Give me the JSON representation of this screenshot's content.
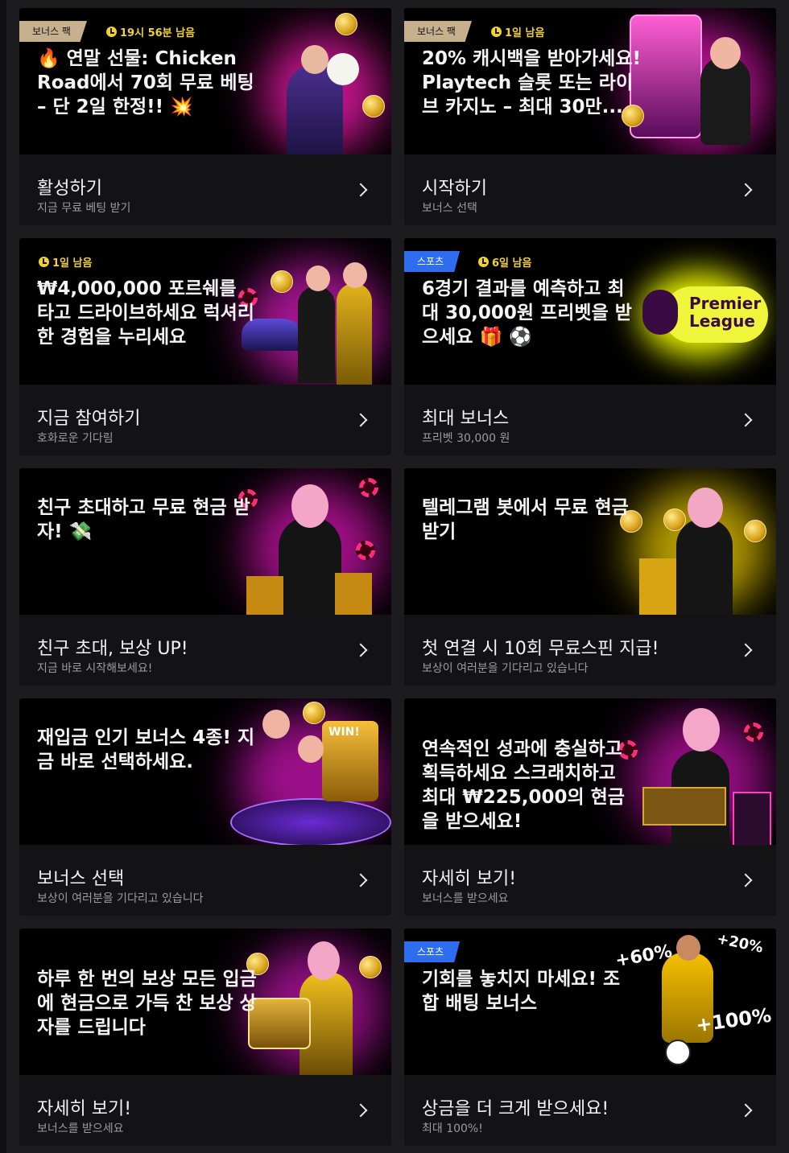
{
  "cards": [
    {
      "tag": "보너스 팩",
      "timer": "19시 56분 남음",
      "headline": "🔥 연말 선물: Chicken Road에서 70회 무료 베팅 – 단 2일 한정!! 💥",
      "cta_title": "활성하기",
      "cta_sub": "지금 무료 베팅 받기",
      "art_icon": "chicken-road-promo-art"
    },
    {
      "tag": "보너스 팩",
      "timer": "1일 남음",
      "headline": "20% 캐시백을 받아가세요! Playtech 슬롯 또는 라이브 카지노 – 최대 30만...",
      "cta_title": "시작하기",
      "cta_sub": "보너스 선택",
      "art_icon": "slot-machine-win-art"
    },
    {
      "tag": "",
      "timer": "1일 남음",
      "headline": "₩4,000,000 포르쉐를 타고 드라이브하세요 럭셔리한 경험을 누리세요",
      "cta_title": "지금 참여하기",
      "cta_sub": "호화로운 기다림",
      "art_icon": "porsche-911-art"
    },
    {
      "tag": "스포츠",
      "timer": "6일 남음",
      "headline": "6경기 결과를 예측하고 최대 30,000원 프리벳을 받으세요 🎁 ⚽",
      "cta_title": "최대 보너스",
      "cta_sub": "프리벳 30,000 원",
      "art_icon": "premier-league-logo",
      "logo_line1": "Premier",
      "logo_line2": "League"
    },
    {
      "tag": "",
      "timer": "",
      "headline": "친구 초대하고 무료 현금 받자! 💸",
      "cta_title": "친구 초대, 보상 UP!",
      "cta_sub": "지금 바로 시작해보세요!",
      "art_icon": "invite-friend-art"
    },
    {
      "tag": "",
      "timer": "",
      "headline": "텔레그램 봇에서 무료 현금 받기",
      "cta_title": "첫 연결 시 10회 무료스핀 지급!",
      "cta_sub": "보상이 여러분을 기다리고 있습니다",
      "art_icon": "telegram-bot-art"
    },
    {
      "tag": "",
      "timer": "",
      "headline": "재입금 인기 보너스 4종! 지금 바로 선택하세요.",
      "cta_title": "보너스 선택",
      "cta_sub": "보상이 여러분을 기다리고 있습니다",
      "art_icon": "roulette-slot-art",
      "art_label": "WIN!"
    },
    {
      "tag": "",
      "timer": "",
      "headline": "연속적인 성과에 충실하고 획득하세요 스크래치하고 최대 ₩225,000의 현금을 받으세요!",
      "cta_title": "자세히 보기!",
      "cta_sub": "보너스를 받으세요",
      "art_icon": "scratch-card-art"
    },
    {
      "tag": "",
      "timer": "",
      "headline": "하루 한 번의 보상 모든 입금에 현금으로 가득 찬 보상 상자를 드립니다",
      "cta_title": "자세히 보기!",
      "cta_sub": "보너스를 받으세요",
      "art_icon": "treasure-chest-art"
    },
    {
      "tag": "스포츠",
      "timer": "",
      "headline": "기회를 놓치지 마세요! 조합 배팅 보너스",
      "cta_title": "상금을 더 크게 받으세요!",
      "cta_sub": "최대 100%!",
      "art_icon": "football-player-art",
      "pct": [
        "+60%",
        "+20%",
        "+100%"
      ]
    }
  ],
  "colors": {
    "background": "#1c1c1f",
    "card": "#000000",
    "card_bottom": "#131315",
    "timer": "#f2d233",
    "tag_bonus": "#c6b08d",
    "tag_sport": "#2f6df0"
  },
  "icons": {
    "chevron": "chevron-right-icon",
    "clock": "clock-icon"
  }
}
